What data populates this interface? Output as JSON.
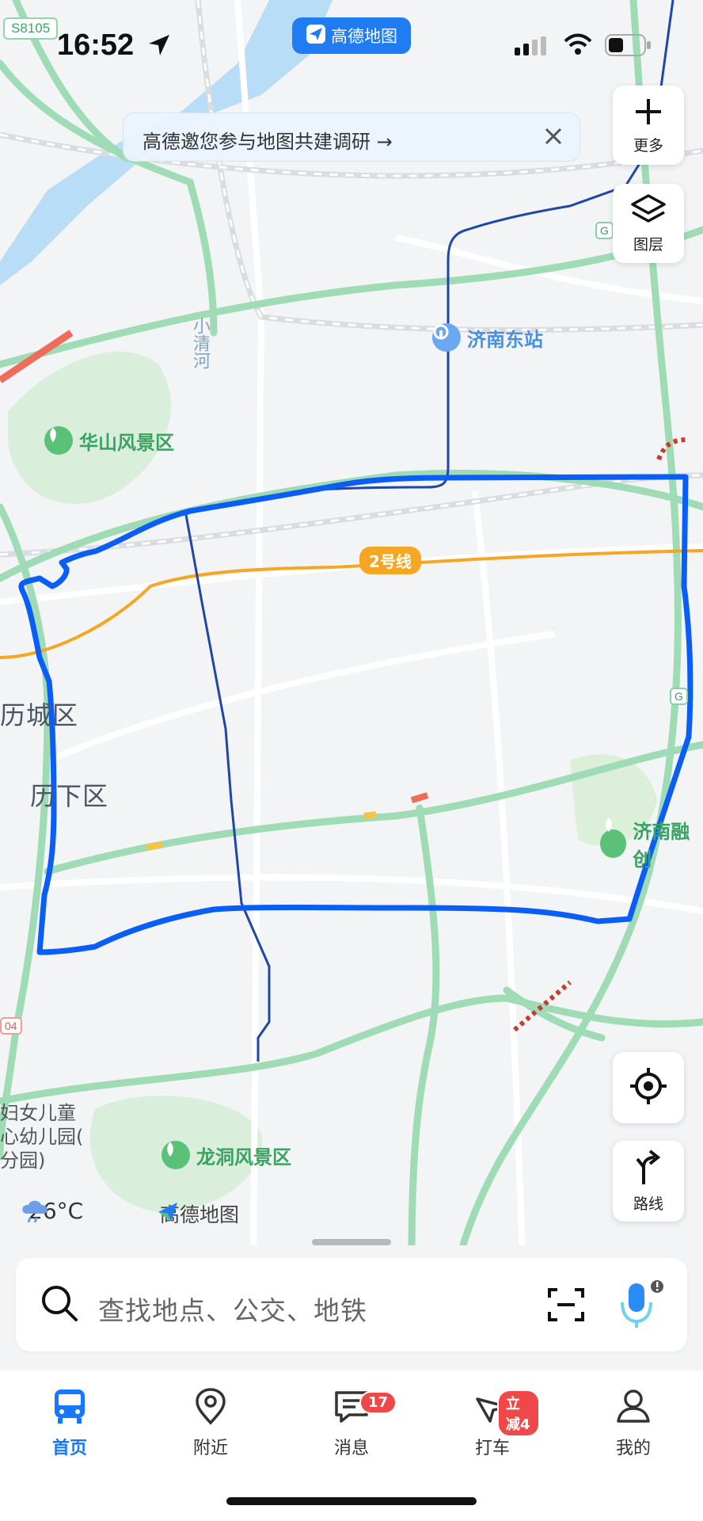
{
  "status_bar": {
    "road_badge": "S8105",
    "time": "16:52",
    "app_name": "高德地图"
  },
  "banner": {
    "text": "高德邀您参与地图共建调研 →"
  },
  "controls": {
    "more_label": "更多",
    "layers_label": "图层",
    "route_label": "路线"
  },
  "map_labels": {
    "station": "济南东站",
    "huashan": "华山风景区",
    "metro_line": "2号线",
    "district_left": "历城区",
    "district_lixia": "历下区",
    "river": "小清河",
    "ronghui": "济南融创",
    "longdong": "龙洞风景区",
    "kindergarten_lines": [
      "妇女儿童",
      "心幼儿园(",
      "分园)"
    ],
    "shield_g1": "G",
    "shield_g2": "G",
    "shield_04": "04"
  },
  "weather": {
    "temp": "26°C",
    "brand": "高德地图"
  },
  "search": {
    "placeholder": "查找地点、公交、地铁"
  },
  "tabs": [
    {
      "label": "首页",
      "active": true
    },
    {
      "label": "附近"
    },
    {
      "label": "消息",
      "badge": "17"
    },
    {
      "label": "打车",
      "badge": "立减4"
    },
    {
      "label": "我的"
    }
  ],
  "colors": {
    "route_blue": "#0a5ef5",
    "metro_line": "#f5a623",
    "highway_green": "#a7e3bd",
    "accent": "#1677ff"
  }
}
